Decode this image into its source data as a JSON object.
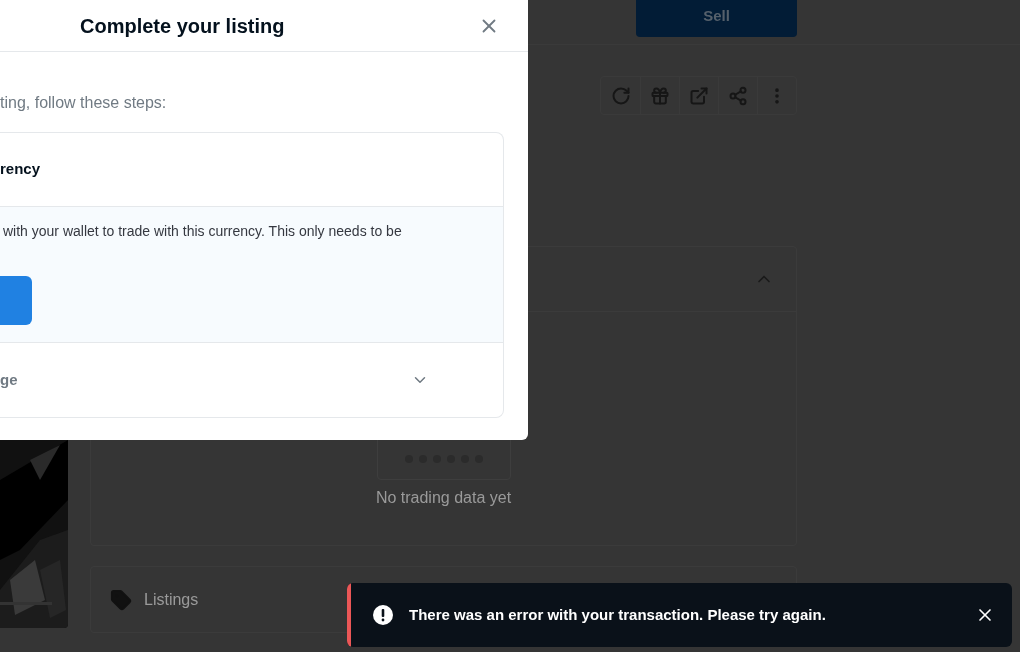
{
  "header": {
    "sell_button": "Sell"
  },
  "price_history": {
    "expanded": true,
    "empty_text": "No trading data yet"
  },
  "listings": {
    "title": "Listings"
  },
  "modal": {
    "title": "Complete your listing",
    "intro": "ting, follow these steps:",
    "steps": [
      {
        "title": "rency",
        "expanded": true,
        "description": "with your wallet to trade with this currency. This only needs to be"
      },
      {
        "title": "ge",
        "expanded": false
      }
    ]
  },
  "toast": {
    "kind": "error",
    "message": "There was an error with your transaction. Please try again."
  }
}
